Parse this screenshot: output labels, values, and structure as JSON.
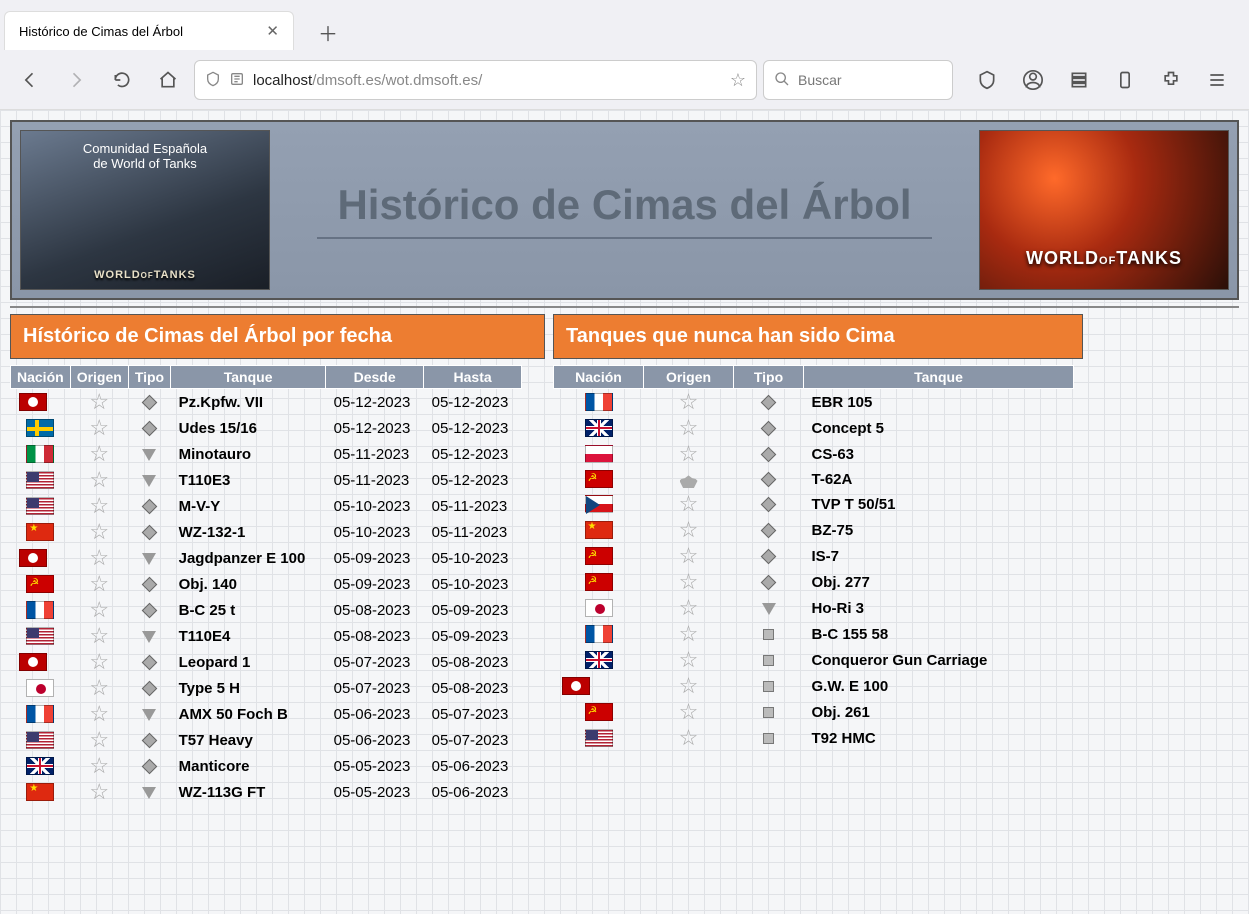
{
  "browser": {
    "tab_title": "Histórico de Cimas del Árbol",
    "url_host": "localhost",
    "url_path": "/dmsoft.es/wot.dmsoft.es/",
    "search_placeholder": "Buscar"
  },
  "banner": {
    "left_line1": "Comunidad Española",
    "left_line2": "de World of Tanks",
    "left_logo": "WORLD OF TANKS",
    "title": "Histórico de Cimas del Árbol",
    "right_logo": "WORLD OF TANKS"
  },
  "table_left": {
    "title": "Hístórico de Cimas del Árbol por fecha",
    "headers": [
      "Nación",
      "Origen",
      "Tipo",
      "Tanque",
      "Desde",
      "Hasta"
    ],
    "rows": [
      {
        "nation": "de-reich",
        "origin": "star",
        "type": "dia",
        "tank": "Pz.Kpfw. VII",
        "from": "05-12-2023",
        "to": "05-12-2023"
      },
      {
        "nation": "se",
        "origin": "star",
        "type": "dia",
        "tank": "Udes 15/16",
        "from": "05-12-2023",
        "to": "05-12-2023"
      },
      {
        "nation": "it",
        "origin": "star",
        "type": "tri",
        "tank": "Minotauro",
        "from": "05-11-2023",
        "to": "05-12-2023"
      },
      {
        "nation": "us",
        "origin": "star",
        "type": "tri",
        "tank": "T110E3",
        "from": "05-11-2023",
        "to": "05-12-2023"
      },
      {
        "nation": "us",
        "origin": "star",
        "type": "dia",
        "tank": "M-V-Y",
        "from": "05-10-2023",
        "to": "05-11-2023"
      },
      {
        "nation": "cn",
        "origin": "star",
        "type": "dia",
        "tank": "WZ-132-1",
        "from": "05-10-2023",
        "to": "05-11-2023"
      },
      {
        "nation": "de-reich",
        "origin": "star",
        "type": "tri",
        "tank": "Jagdpanzer E 100",
        "from": "05-09-2023",
        "to": "05-10-2023"
      },
      {
        "nation": "su",
        "origin": "star",
        "type": "dia",
        "tank": "Obj. 140",
        "from": "05-09-2023",
        "to": "05-10-2023"
      },
      {
        "nation": "fr",
        "origin": "star",
        "type": "dia",
        "tank": "B-C 25 t",
        "from": "05-08-2023",
        "to": "05-09-2023"
      },
      {
        "nation": "us",
        "origin": "star",
        "type": "tri",
        "tank": "T110E4",
        "from": "05-08-2023",
        "to": "05-09-2023"
      },
      {
        "nation": "de-reich",
        "origin": "star",
        "type": "dia",
        "tank": "Leopard 1",
        "from": "05-07-2023",
        "to": "05-08-2023"
      },
      {
        "nation": "jp",
        "origin": "star",
        "type": "dia",
        "tank": "Type 5 H",
        "from": "05-07-2023",
        "to": "05-08-2023"
      },
      {
        "nation": "fr",
        "origin": "star",
        "type": "tri",
        "tank": "AMX 50 Foch B",
        "from": "05-06-2023",
        "to": "05-07-2023"
      },
      {
        "nation": "us",
        "origin": "star",
        "type": "dia",
        "tank": "T57 Heavy",
        "from": "05-06-2023",
        "to": "05-07-2023"
      },
      {
        "nation": "uk",
        "origin": "star",
        "type": "dia",
        "tank": "Manticore",
        "from": "05-05-2023",
        "to": "05-06-2023"
      },
      {
        "nation": "cn",
        "origin": "star",
        "type": "tri",
        "tank": "WZ-113G FT",
        "from": "05-05-2023",
        "to": "05-06-2023"
      }
    ]
  },
  "table_right": {
    "title": "Tanques que nunca han sido Cima",
    "headers": [
      "Nación",
      "Origen",
      "Tipo",
      "Tanque"
    ],
    "rows": [
      {
        "nation": "fr",
        "origin": "star",
        "type": "dia",
        "tank": "EBR 105"
      },
      {
        "nation": "uk",
        "origin": "star",
        "type": "dia",
        "tank": "Concept 5"
      },
      {
        "nation": "pl",
        "origin": "star",
        "type": "dia",
        "tank": "CS-63"
      },
      {
        "nation": "su",
        "origin": "lock",
        "type": "dia",
        "tank": "T-62A"
      },
      {
        "nation": "cz",
        "origin": "star",
        "type": "dia",
        "tank": "TVP T 50/51"
      },
      {
        "nation": "cn",
        "origin": "star",
        "type": "dia",
        "tank": "BZ-75"
      },
      {
        "nation": "su",
        "origin": "star",
        "type": "dia",
        "tank": "IS-7"
      },
      {
        "nation": "su",
        "origin": "star",
        "type": "dia",
        "tank": "Obj. 277"
      },
      {
        "nation": "jp",
        "origin": "star",
        "type": "tri",
        "tank": "Ho-Ri 3"
      },
      {
        "nation": "fr",
        "origin": "star",
        "type": "sq",
        "tank": "B-C 155 58"
      },
      {
        "nation": "uk",
        "origin": "star",
        "type": "sq",
        "tank": "Conqueror Gun Carriage"
      },
      {
        "nation": "de-reich",
        "origin": "star",
        "type": "sq",
        "tank": "G.W. E 100"
      },
      {
        "nation": "su",
        "origin": "star",
        "type": "sq",
        "tank": "Obj. 261"
      },
      {
        "nation": "us",
        "origin": "star",
        "type": "sq",
        "tank": "T92 HMC"
      }
    ]
  }
}
